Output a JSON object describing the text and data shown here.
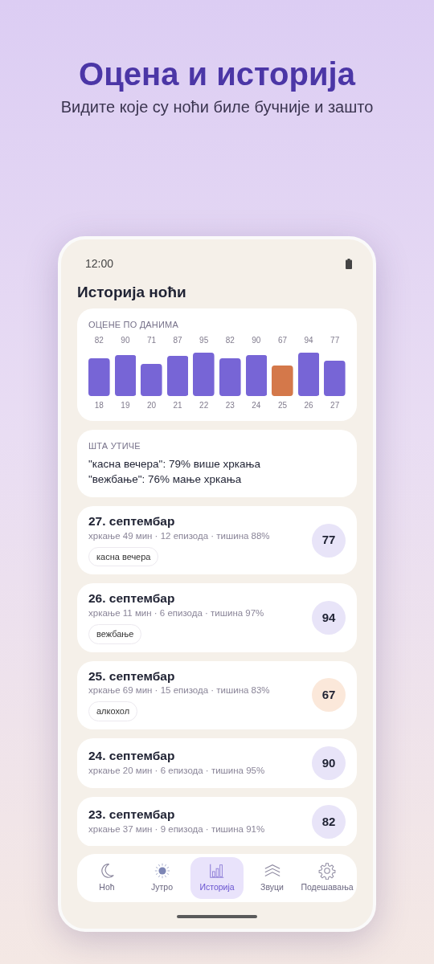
{
  "promo": {
    "title": "Оцена и историја",
    "subtitle": "Видите које су ноћи биле бучније и зашто"
  },
  "status_bar": {
    "time": "12:00"
  },
  "screen_title": "Историја ноћи",
  "scores_card": {
    "heading": "ОЦЕНЕ ПО ДАНИМА",
    "chart_data": {
      "type": "bar",
      "data_labels": true,
      "ylim": [
        0,
        100
      ],
      "categories": [
        "18",
        "19",
        "20",
        "21",
        "22",
        "23",
        "24",
        "25",
        "26",
        "27"
      ],
      "values": [
        82,
        90,
        71,
        87,
        95,
        82,
        90,
        67,
        94,
        77
      ],
      "colors": [
        "#7765d6",
        "#7765d6",
        "#7765d6",
        "#7765d6",
        "#7765d6",
        "#7765d6",
        "#7765d6",
        "#d4784a",
        "#7765d6",
        "#7765d6"
      ]
    }
  },
  "factors_card": {
    "heading": "ШТА УТИЧЕ",
    "lines": [
      "\"касна вечера\": 79% више хркања",
      "\"вежбање\": 76% мање хркања"
    ]
  },
  "nights": [
    {
      "date": "27. септембар",
      "stats": "хркање 49 мин · 12 епизода · тишина 88%",
      "tag": "касна вечера",
      "score": "77",
      "color": "#e8e4f8"
    },
    {
      "date": "26. септембар",
      "stats": "хркање 11 мин · 6 епизода · тишина 97%",
      "tag": "вежбање",
      "score": "94",
      "color": "#e8e4f8"
    },
    {
      "date": "25. септембар",
      "stats": "хркање 69 мин · 15 епизода · тишина 83%",
      "tag": "алкохол",
      "score": "67",
      "color": "#fbe8da"
    },
    {
      "date": "24. септембар",
      "stats": "хркање 20 мин · 6 епизода · тишина 95%",
      "score": "90",
      "color": "#e8e4f8"
    },
    {
      "date": "23. септембар",
      "stats": "хркање 37 мин · 9 епизода · тишина 91%",
      "score": "82",
      "color": "#e8e4f8"
    }
  ],
  "bottom_nav": [
    {
      "label": "Ноћ",
      "kind": "moon",
      "selected": false
    },
    {
      "label": "Јутро",
      "kind": "sun",
      "selected": false
    },
    {
      "label": "Историја",
      "kind": "chart",
      "selected": true
    },
    {
      "label": "Звуци",
      "kind": "waves",
      "selected": false
    },
    {
      "label": "Подешавања",
      "kind": "gear",
      "selected": false
    }
  ]
}
